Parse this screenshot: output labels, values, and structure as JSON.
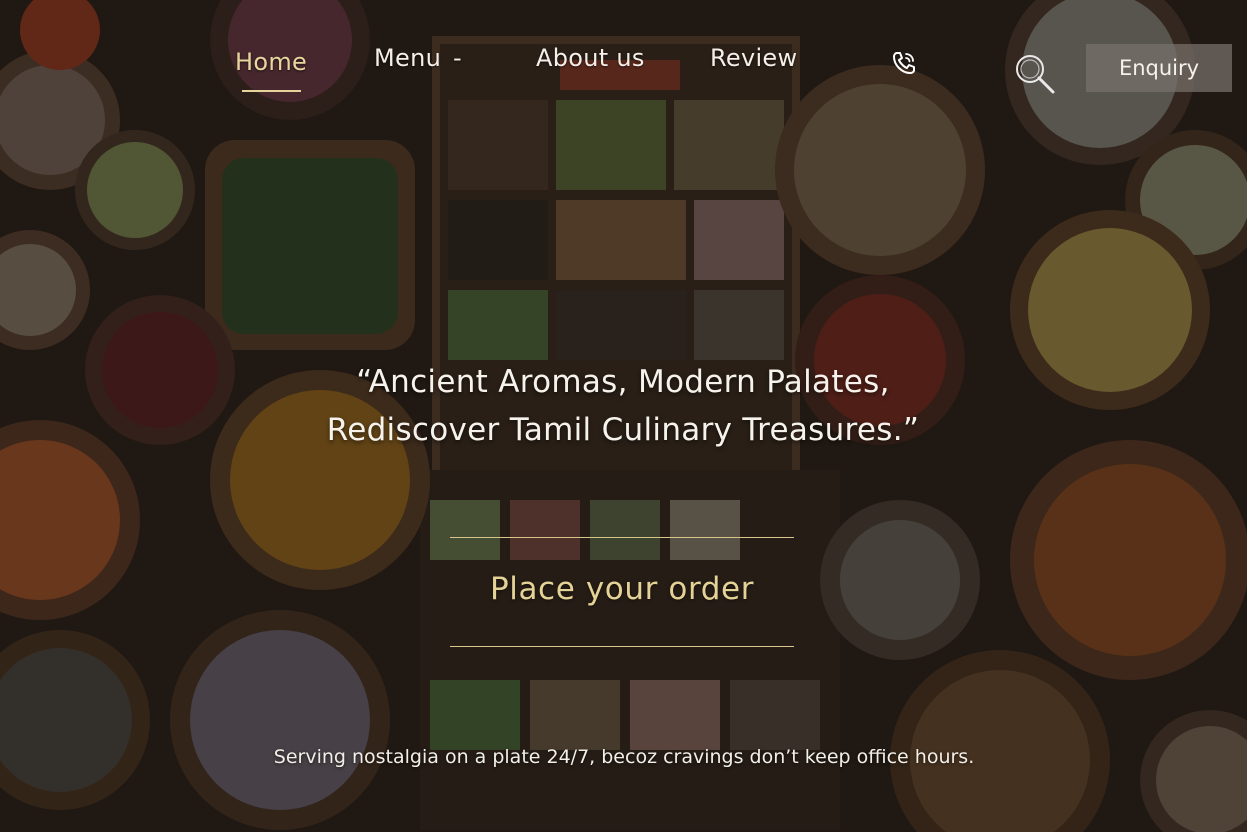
{
  "colors": {
    "accent_gold": "#e6d49a",
    "text_light": "#f4efe9",
    "enquiry_bg": "#78726c"
  },
  "nav": {
    "items": [
      {
        "label": "Home",
        "active": true
      },
      {
        "label": "Menu"
      },
      {
        "label": "About us"
      },
      {
        "label": "Review"
      }
    ],
    "menu_dropdown_indicator": "-",
    "phone_icon": "phone-icon",
    "search_icon": "search-icon",
    "enquiry_label": "Enquiry"
  },
  "hero": {
    "background": "spices-flatlay-image",
    "tagline_line1": "“Ancient Aromas, Modern Palates,",
    "tagline_line2": "Rediscover Tamil Culinary Treasures.”",
    "order_label": "Place your order",
    "serving_text": "Serving nostalgia on a plate 24/7, becoz cravings don’t keep office hours."
  }
}
